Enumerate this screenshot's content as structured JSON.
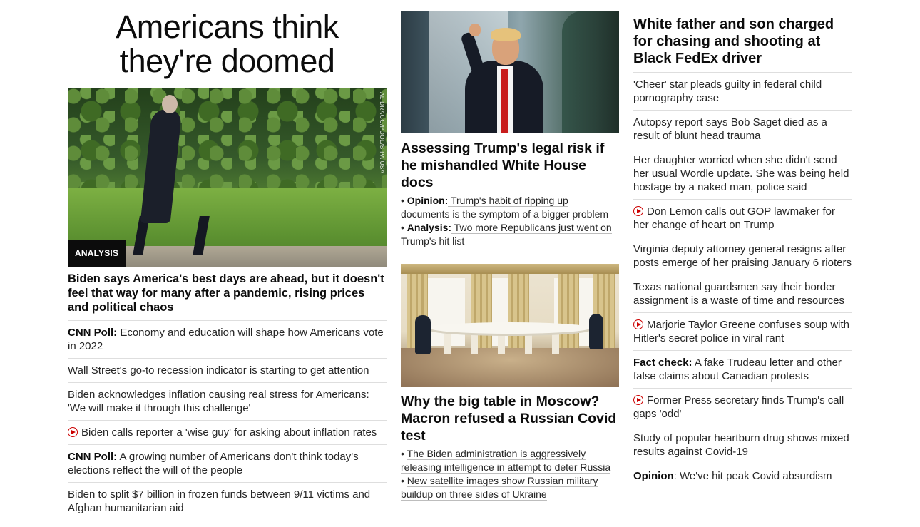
{
  "col1": {
    "headline": "Americans think they're doomed",
    "image_credit": "AL DRAGO/POOL/SIPA USA",
    "badge": "ANALYSIS",
    "story_headline": "Biden says America's best days are ahead, but it doesn't feel that way for many after a pandemic, rising prices and political chaos",
    "items": [
      {
        "prefix": "CNN Poll:",
        "text": " Economy and education will shape how Americans vote in 2022"
      },
      {
        "prefix": "",
        "text": "Wall Street's go-to recession indicator is starting to get attention"
      },
      {
        "prefix": "",
        "text": "Biden acknowledges inflation causing real stress for Americans: 'We will make it through this challenge'"
      },
      {
        "prefix": "",
        "text": "Biden calls reporter a 'wise guy' for asking about inflation rates",
        "video": true
      },
      {
        "prefix": "CNN Poll:",
        "text": " A growing number of Americans don't think today's elections reflect the will of the people"
      },
      {
        "prefix": "",
        "text": "Biden to split $7 billion in frozen funds between 9/11 victims and Afghan humanitarian aid"
      }
    ]
  },
  "col2": {
    "story1": {
      "headline": "Assessing Trump's legal risk if he mishandled White House docs",
      "links": [
        {
          "bullet": "• ",
          "prefix": "Opinion:",
          "text": " Trump's habit of ripping up documents is the symptom of a bigger problem"
        },
        {
          "bullet": "• ",
          "prefix": "Analysis:",
          "text": " Two more Republicans just went on Trump's hit list"
        }
      ]
    },
    "story2": {
      "headline": "Why the big table in Moscow? Macron refused a Russian Covid test",
      "links": [
        {
          "bullet": "• ",
          "prefix": "",
          "text": "The Biden administration is aggressively releasing intelligence in attempt to deter Russia"
        },
        {
          "bullet": "• ",
          "prefix": "",
          "text": "New satellite images show Russian military buildup on three sides of Ukraine"
        }
      ]
    }
  },
  "col3": {
    "headline": "White father and son charged for chasing and shooting at Black FedEx driver",
    "items": [
      {
        "prefix": "",
        "text": "'Cheer' star pleads guilty in federal child pornography case"
      },
      {
        "prefix": "",
        "text": "Autopsy report says Bob Saget died as a result of blunt head trauma"
      },
      {
        "prefix": "",
        "text": "Her daughter worried when she didn't send her usual Wordle update. She was being held hostage by a naked man, police said"
      },
      {
        "prefix": "",
        "text": "Don Lemon calls out GOP lawmaker for her change of heart on Trump",
        "video": true
      },
      {
        "prefix": "",
        "text": "Virginia deputy attorney general resigns after posts emerge of her praising January 6 rioters"
      },
      {
        "prefix": "",
        "text": "Texas national guardsmen say their border assignment is a waste of time and resources"
      },
      {
        "prefix": "",
        "text": "Marjorie Taylor Greene confuses soup with Hitler's secret police in viral rant",
        "video": true
      },
      {
        "prefix": "Fact check:",
        "text": " A fake Trudeau letter and other false claims about Canadian protests"
      },
      {
        "prefix": "",
        "text": "Former Press secretary finds Trump's call gaps 'odd'",
        "video": true
      },
      {
        "prefix": "",
        "text": "Study of popular heartburn drug shows mixed results against Covid-19"
      },
      {
        "prefix": "Opinion",
        "text": ": We've hit peak Covid absurdism"
      }
    ]
  }
}
